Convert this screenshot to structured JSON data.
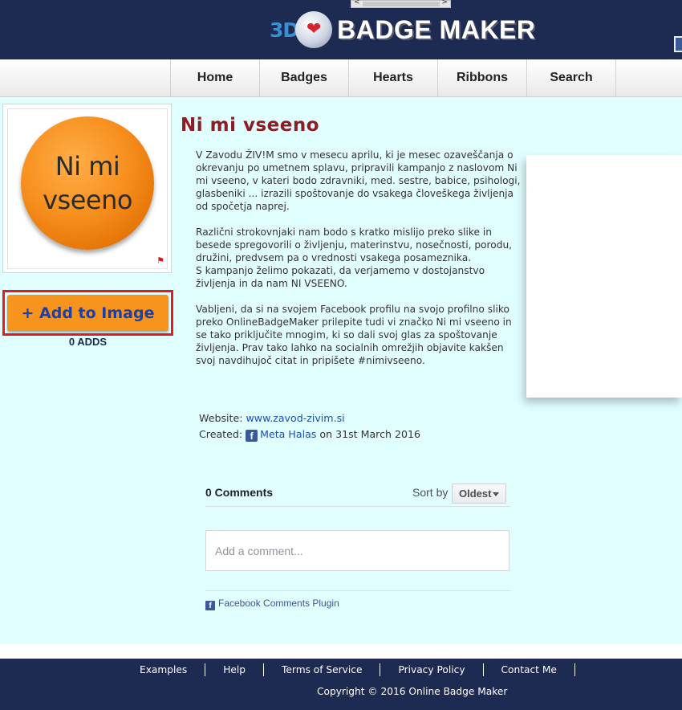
{
  "header": {
    "logo_3d": "3D",
    "logo_text": "BADGE MAKER",
    "scroll_left": "<",
    "scroll_right": ">"
  },
  "nav": {
    "items": [
      "Home",
      "Badges",
      "Hearts",
      "Ribbons",
      "Search"
    ]
  },
  "badge": {
    "line1": "Ni mi",
    "line2": "vseeno",
    "color": "#f7901e",
    "flag_icon": "flag-icon"
  },
  "add_button": {
    "label": "+ Add to Image",
    "adds": "0 ADDS"
  },
  "title": "Ni mi vseeno",
  "description": {
    "p1": "V Zavodu ŽIV!M smo v mesecu aprilu, ki je mesec ozaveščanja o okrevanju po umetnem splavu, pripravili kampanjo z naslovom Ni mi vseeno, v kateri bodo zdravniki, med. sestre, babice, psihologi, glasbeniki ... izrazili spoštovanje do vsakega človeškega življenja od spočetja naprej.",
    "p2a": "Različni strokovnjaki nam bodo s kratko mislijo preko slike in besede spregovorili o življenju, materinstvu, nosečnosti, porodu, družini, predvsem pa o vrednosti vsakega posameznika.",
    "p2b": "S kampanjo želimo pokazati, da verjamemo v dostojanstvo življenja in da nam NI VSEENO.",
    "p3": "Vabljeni, da si na svojem Facebook profilu na svojo profilno sliko preko OnlineBadgeMaker prilepite tudi vi značko Ni mi vseeno in se tako priključite mnogim, ki so dali svoj glas za spoštovanje življenja. Prav tako lahko na socialnih omrežjih objavite kakšen svoj navdihujoč citat in pripišete #nimivseeno."
  },
  "meta": {
    "website_label": "Website:",
    "website_url": "www.zavod-zivim.si",
    "created_label": "Created:",
    "author": "Meta Halas",
    "date": "on 31st March 2016"
  },
  "comments": {
    "count": "0 Comments",
    "sort_label": "Sort by",
    "sort_value": "Oldest",
    "placeholder": "Add a comment...",
    "plugin": "Facebook Comments Plugin"
  },
  "footer": {
    "links": [
      "Examples",
      "Help",
      "Terms of Service",
      "Privacy Policy",
      "Contact Me"
    ],
    "copyright": "Copyright © 2016 Online Badge Maker"
  },
  "colors": {
    "header_bg": "#1d2a52",
    "main_bg": "#e1feff",
    "title": "#8b1d24",
    "button": "#f7941d",
    "button_text": "#1c3fa8",
    "highlight_border": "#e01b24"
  }
}
